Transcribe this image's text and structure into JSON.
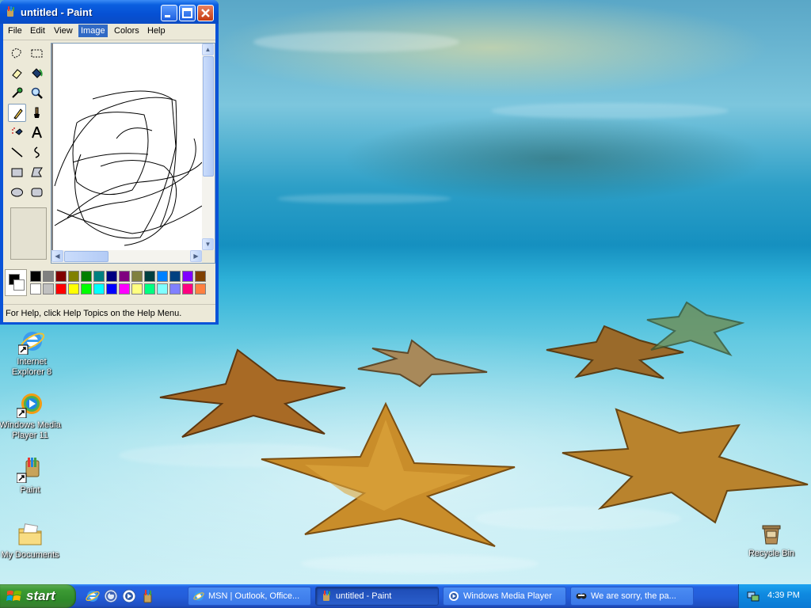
{
  "paint": {
    "title": "untitled - Paint",
    "menu": [
      "File",
      "Edit",
      "View",
      "Image",
      "Colors",
      "Help"
    ],
    "active_menu": "Image",
    "selected_tool": "pencil",
    "status": "For Help, click Help Topics on the Help Menu.",
    "foreground_color": "#000000",
    "background_color": "#ffffff",
    "palette_row1": [
      "#000000",
      "#808080",
      "#800000",
      "#808000",
      "#008000",
      "#008080",
      "#000080",
      "#800080",
      "#808040",
      "#004040",
      "#0080ff",
      "#004080",
      "#8000ff",
      "#804000"
    ],
    "palette_row2": [
      "#ffffff",
      "#c0c0c0",
      "#ff0000",
      "#ffff00",
      "#00ff00",
      "#00ffff",
      "#0000ff",
      "#ff00ff",
      "#ffff80",
      "#00ff80",
      "#80ffff",
      "#8080ff",
      "#ff0080",
      "#ff8040"
    ]
  },
  "desktop": {
    "icons": [
      {
        "label": "Internet Explorer 8",
        "icon": "internet-explorer-icon"
      },
      {
        "label": "Windows Media Player 11",
        "icon": "windows-media-player-icon"
      },
      {
        "label": "Paint",
        "icon": "paint-icon"
      },
      {
        "label": "My Documents",
        "icon": "my-documents-icon"
      },
      {
        "label": "Recycle Bin",
        "icon": "recycle-bin-icon"
      }
    ]
  },
  "taskbar": {
    "start_label": "start",
    "quick_launch": [
      "internet-explorer-icon",
      "messenger-icon",
      "windows-media-player-icon",
      "paint-icon"
    ],
    "buttons": [
      {
        "label": "MSN | Outlook, Office...",
        "icon": "msn-icon",
        "active": false
      },
      {
        "label": "untitled - Paint",
        "icon": "paint-icon",
        "active": true
      },
      {
        "label": "Windows Media Player",
        "icon": "windows-media-player-icon",
        "active": false
      },
      {
        "label": "We are sorry, the pa...",
        "icon": "alert-icon",
        "active": false
      }
    ],
    "clock": "4:39 PM"
  }
}
